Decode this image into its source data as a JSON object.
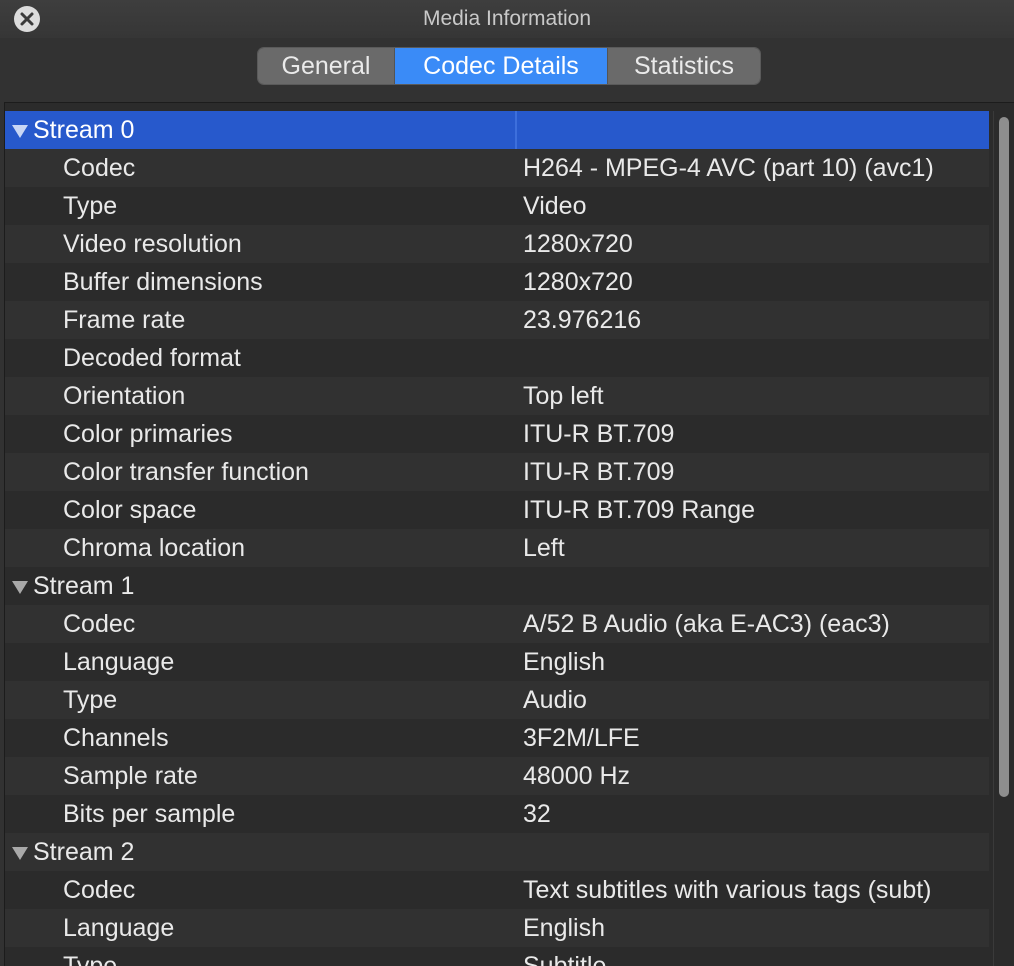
{
  "window": {
    "title": "Media Information"
  },
  "tabs": [
    {
      "label": "General",
      "active": false
    },
    {
      "label": "Codec Details",
      "active": true
    },
    {
      "label": "Statistics",
      "active": false
    }
  ],
  "colors": {
    "accent": "#3a8bf7",
    "selection": "#2759cc"
  },
  "streams": [
    {
      "label": "Stream 0",
      "rows": [
        {
          "label": "Codec",
          "value": "H264 - MPEG-4 AVC (part 10) (avc1)"
        },
        {
          "label": "Type",
          "value": "Video"
        },
        {
          "label": "Video resolution",
          "value": "1280x720"
        },
        {
          "label": "Buffer dimensions",
          "value": "1280x720"
        },
        {
          "label": "Frame rate",
          "value": "23.976216"
        },
        {
          "label": "Decoded format",
          "value": ""
        },
        {
          "label": "Orientation",
          "value": "Top left"
        },
        {
          "label": "Color primaries",
          "value": "ITU-R BT.709"
        },
        {
          "label": "Color transfer function",
          "value": "ITU-R BT.709"
        },
        {
          "label": "Color space",
          "value": "ITU-R BT.709 Range"
        },
        {
          "label": "Chroma location",
          "value": "Left"
        }
      ]
    },
    {
      "label": "Stream 1",
      "rows": [
        {
          "label": "Codec",
          "value": "A/52 B Audio (aka E-AC3) (eac3)"
        },
        {
          "label": "Language",
          "value": "English"
        },
        {
          "label": "Type",
          "value": "Audio"
        },
        {
          "label": "Channels",
          "value": "3F2M/LFE"
        },
        {
          "label": "Sample rate",
          "value": "48000 Hz"
        },
        {
          "label": "Bits per sample",
          "value": "32"
        }
      ]
    },
    {
      "label": "Stream 2",
      "rows": [
        {
          "label": "Codec",
          "value": "Text subtitles with various tags (subt)"
        },
        {
          "label": "Language",
          "value": "English"
        },
        {
          "label": "Type",
          "value": "Subtitle"
        }
      ]
    }
  ]
}
